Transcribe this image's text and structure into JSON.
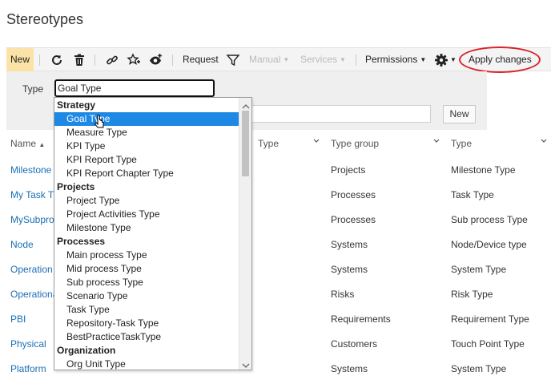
{
  "page": {
    "title": "Stereotypes"
  },
  "toolbar": {
    "new_label": "New",
    "request_label": "Request",
    "manual_label": "Manual",
    "services_label": "Services",
    "permissions_label": "Permissions",
    "apply_label": "Apply changes",
    "icons": [
      "refresh-icon",
      "delete-icon",
      "link-icon",
      "star-add-icon",
      "eye-add-icon",
      "filter-icon",
      "gear-icon"
    ],
    "highlight_color": "#d8232a"
  },
  "filter": {
    "type_label": "Type",
    "type_value": "Goal Type",
    "new_label": "New"
  },
  "table": {
    "headers": {
      "name": "Name",
      "type_col": "Type",
      "type_group": "Type group",
      "type": "Type"
    },
    "rows": [
      {
        "name": "Milestone",
        "group": "Projects",
        "type": "Milestone Type"
      },
      {
        "name": "My Task Ty",
        "group": "Processes",
        "type": "Task Type"
      },
      {
        "name": "MySubpro",
        "group": "Processes",
        "type": "Sub process Type"
      },
      {
        "name": "Node",
        "group": "Systems",
        "type": "Node/Device type"
      },
      {
        "name": "Operation",
        "group": "Systems",
        "type": "System Type"
      },
      {
        "name": "Operationa",
        "group": "Risks",
        "type": "Risk Type"
      },
      {
        "name": "PBI",
        "group": "Requirements",
        "type": "Requirement Type"
      },
      {
        "name": "Physical",
        "group": "Customers",
        "type": "Touch Point Type"
      },
      {
        "name": "Platform",
        "group": "Systems",
        "type": "System Type"
      }
    ]
  },
  "dropdown": {
    "selected_color": "#1e88e5",
    "items": [
      {
        "kind": "group",
        "label": "Strategy"
      },
      {
        "kind": "option",
        "label": "Goal Type",
        "selected": true
      },
      {
        "kind": "option",
        "label": "Measure Type"
      },
      {
        "kind": "option",
        "label": "KPI Type"
      },
      {
        "kind": "option",
        "label": "KPI Report Type"
      },
      {
        "kind": "option",
        "label": "KPI Report Chapter Type"
      },
      {
        "kind": "group",
        "label": "Projects"
      },
      {
        "kind": "option",
        "label": "Project Type"
      },
      {
        "kind": "option",
        "label": "Project Activities Type"
      },
      {
        "kind": "option",
        "label": "Milestone Type"
      },
      {
        "kind": "group",
        "label": "Processes"
      },
      {
        "kind": "option",
        "label": "Main process Type"
      },
      {
        "kind": "option",
        "label": "Mid process Type"
      },
      {
        "kind": "option",
        "label": "Sub process Type"
      },
      {
        "kind": "option",
        "label": "Scenario Type"
      },
      {
        "kind": "option",
        "label": "Task Type"
      },
      {
        "kind": "option",
        "label": "Repository-Task Type"
      },
      {
        "kind": "option",
        "label": "BestPracticeTaskType"
      },
      {
        "kind": "group",
        "label": "Organization"
      },
      {
        "kind": "option",
        "label": "Org Unit Type"
      }
    ]
  }
}
